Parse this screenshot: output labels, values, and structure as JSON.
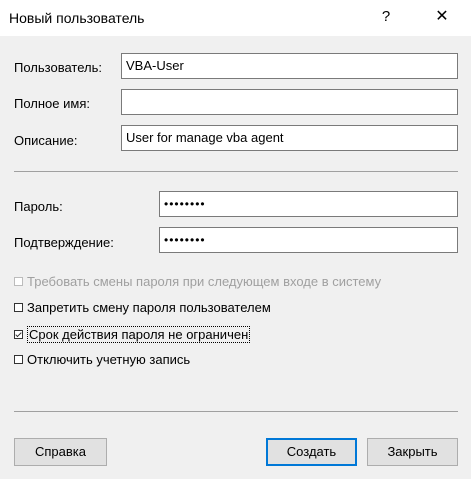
{
  "window": {
    "title": "Новый пользователь",
    "help_icon": "?",
    "close_icon": "✕"
  },
  "fields": {
    "user_label": "Пользователь:",
    "user_value": "VBA-User",
    "fullname_label": "Полное имя:",
    "fullname_value": "",
    "description_label": "Описание:",
    "description_value": "User for manage vba agent",
    "password_label": "Пароль:",
    "password_value": "••••••••",
    "confirm_label": "Подтверждение:",
    "confirm_value": "••••••••"
  },
  "options": [
    {
      "label": "Требовать смены пароля при следующем входе в систему",
      "checked": false,
      "disabled": true
    },
    {
      "label": "Запретить смену пароля пользователем",
      "checked": false,
      "disabled": false
    },
    {
      "label": "Срок действия пароля не ограничен",
      "checked": true,
      "disabled": false
    },
    {
      "label": "Отключить учетную запись",
      "checked": false,
      "disabled": false
    }
  ],
  "buttons": {
    "help": "Справка",
    "create": "Создать",
    "close": "Закрыть"
  }
}
